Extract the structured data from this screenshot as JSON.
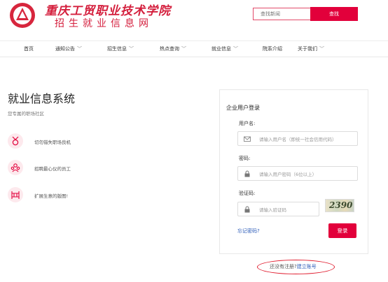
{
  "header": {
    "school_name": "重庆工贸职业技术学院",
    "site_name": "招生就业信息网",
    "search_placeholder": "查找新闻",
    "search_button": "查找"
  },
  "nav": {
    "items": [
      {
        "label": "首页",
        "dropdown": false
      },
      {
        "label": "通知公告",
        "dropdown": true
      },
      {
        "label": "招生信息",
        "dropdown": true
      },
      {
        "label": "热点查询",
        "dropdown": true
      },
      {
        "label": "就业信息",
        "dropdown": true
      },
      {
        "label": "院系介绍",
        "dropdown": false
      },
      {
        "label": "关于我们",
        "dropdown": true
      }
    ],
    "chevron": "﹀"
  },
  "intro": {
    "title": "就业信息系统",
    "subtitle": "您专属的职场社区",
    "features": [
      {
        "icon": "medal-icon",
        "text": "切勿错失职场良机"
      },
      {
        "icon": "people-icon",
        "text": "招聘最心仪的员工"
      },
      {
        "icon": "fence-icon",
        "text": "扩展生意的版图!"
      }
    ]
  },
  "login": {
    "title": "企业用户登录",
    "username_label": "用户名:",
    "username_placeholder": "请输入用户名（即统一社会信用代码）",
    "password_label": "密码:",
    "password_placeholder": "请输入用户密码（6位以上）",
    "captcha_label": "验证码:",
    "captcha_placeholder": "请输入验证码",
    "captcha_text": "2390",
    "forgot_label": "忘记密码?",
    "login_button": "登录"
  },
  "register": {
    "prompt": "还没有注册?",
    "link": "建立账号"
  },
  "colors": {
    "brand": "#d41e3c",
    "button": "#e2003b",
    "link": "#2b5bb8"
  }
}
